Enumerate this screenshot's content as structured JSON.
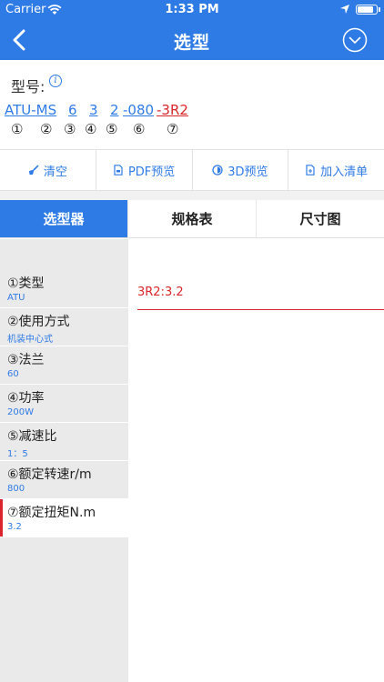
{
  "status": {
    "carrier": "Carrier",
    "time": "1:33 PM"
  },
  "nav": {
    "title": "选型"
  },
  "model": {
    "label": "型号:",
    "segments": [
      {
        "text": "ATU-MS",
        "active": false
      },
      {
        "text": "6",
        "active": false
      },
      {
        "text": "3",
        "active": false
      },
      {
        "text": "2",
        "active": false
      },
      {
        "text": "-080",
        "active": false
      },
      {
        "text": "-3R2",
        "active": true
      }
    ],
    "numbers": [
      "①",
      "②",
      "③",
      "④",
      "⑤",
      "⑥",
      "⑦"
    ]
  },
  "toolbar": [
    {
      "label": "清空",
      "icon": "broom-icon"
    },
    {
      "label": "PDF预览",
      "icon": "pdf-icon"
    },
    {
      "label": "3D预览",
      "icon": "3d-icon"
    },
    {
      "label": "加入清单",
      "icon": "add-list-icon"
    }
  ],
  "tabs": [
    "选型器",
    "规格表",
    "尺寸图"
  ],
  "params": [
    {
      "name": "①类型",
      "value": "ATU"
    },
    {
      "name": "②使用方式",
      "value": "机装中心式"
    },
    {
      "name": "③法兰",
      "value": "60"
    },
    {
      "name": "④功率",
      "value": "200W"
    },
    {
      "name": "⑤减速比",
      "value": "1：5"
    },
    {
      "name": "⑥额定转速r/m",
      "value": "800"
    },
    {
      "name": "⑦额定扭矩N.m",
      "value": "3.2"
    }
  ],
  "option": {
    "text": "3R2:3.2"
  },
  "colors": {
    "primary": "#2f7be5",
    "accent": "#d9252b"
  }
}
